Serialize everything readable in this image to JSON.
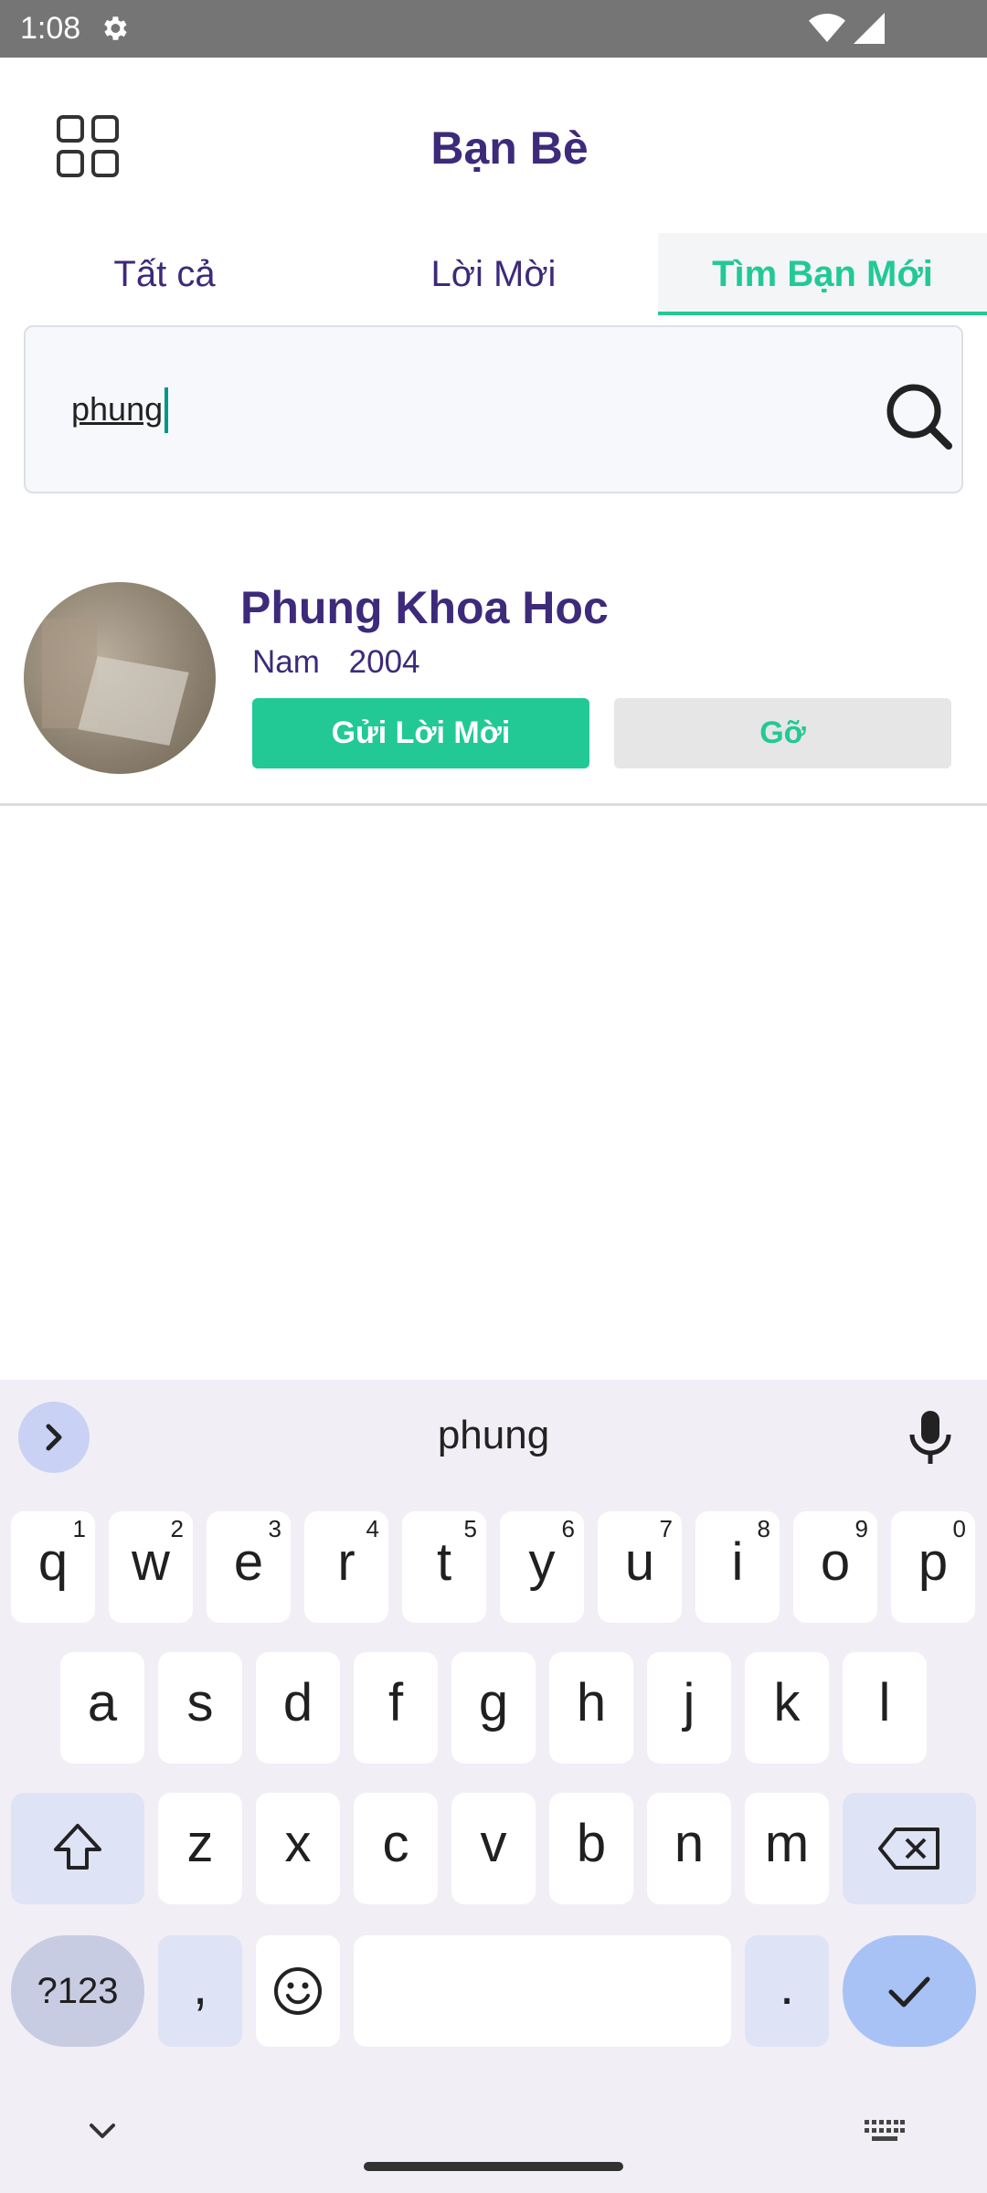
{
  "status_bar": {
    "time": "1:08"
  },
  "header": {
    "title": "Bạn Bè"
  },
  "tabs": [
    {
      "label": "Tất cả",
      "active": false
    },
    {
      "label": "Lời Mời",
      "active": false
    },
    {
      "label": "Tìm Bạn Mới",
      "active": true
    }
  ],
  "search": {
    "value": "phung",
    "placeholder": ""
  },
  "results": [
    {
      "name": "Phung Khoa Hoc",
      "gender": "Nam",
      "year": "2004",
      "send_label": "Gửi Lời Mời",
      "remove_label": "Gỡ"
    }
  ],
  "keyboard": {
    "suggestion": "phung",
    "row1": [
      {
        "key": "q",
        "hint": "1"
      },
      {
        "key": "w",
        "hint": "2"
      },
      {
        "key": "e",
        "hint": "3"
      },
      {
        "key": "r",
        "hint": "4"
      },
      {
        "key": "t",
        "hint": "5"
      },
      {
        "key": "y",
        "hint": "6"
      },
      {
        "key": "u",
        "hint": "7"
      },
      {
        "key": "i",
        "hint": "8"
      },
      {
        "key": "o",
        "hint": "9"
      },
      {
        "key": "p",
        "hint": "0"
      }
    ],
    "row2": [
      "a",
      "s",
      "d",
      "f",
      "g",
      "h",
      "j",
      "k",
      "l"
    ],
    "row3": [
      "z",
      "x",
      "c",
      "v",
      "b",
      "n",
      "m"
    ],
    "symbols_label": "?123",
    "comma": ",",
    "period": "."
  },
  "colors": {
    "accent": "#22c995",
    "title": "#3d2a7a",
    "status_bar": "#757575"
  }
}
